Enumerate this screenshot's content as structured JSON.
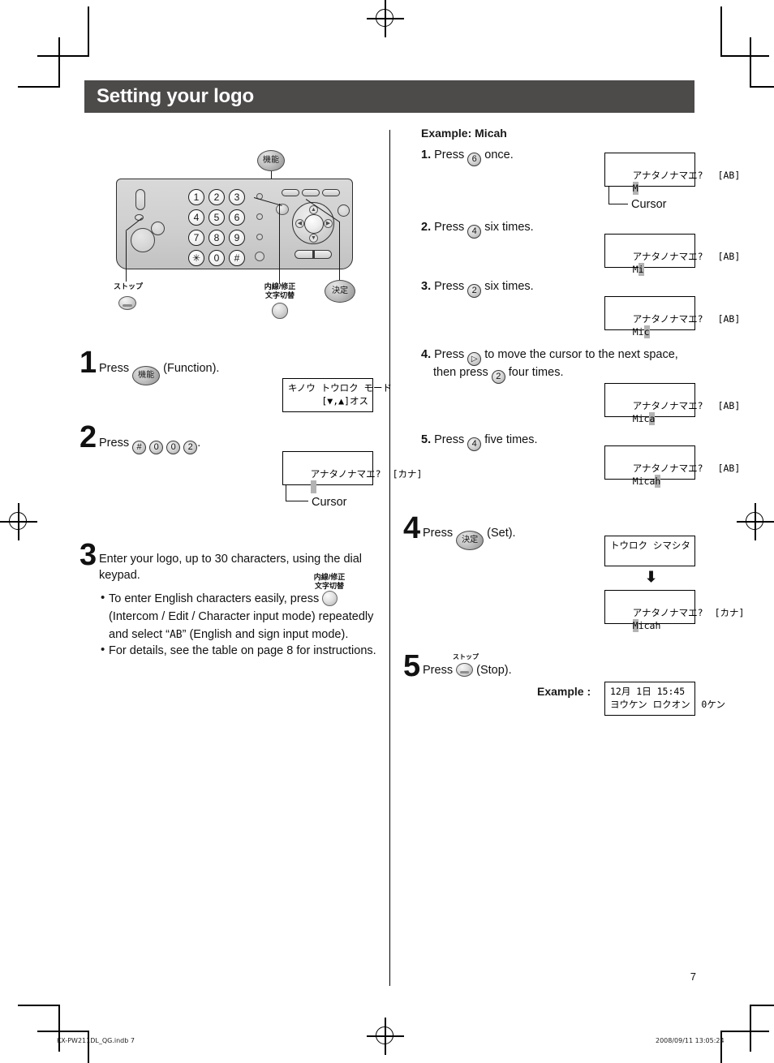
{
  "page": {
    "title": "Setting your logo",
    "page_number": "7",
    "footer_left": "KX-PW211DL_QG.indb   7",
    "footer_right": "2008/09/11   13:05:24"
  },
  "phone_diagram": {
    "keypad": [
      "1",
      "2",
      "3",
      "4",
      "5",
      "6",
      "7",
      "8",
      "9",
      "✳",
      "0",
      "#"
    ],
    "callouts": {
      "function": "機能",
      "stop": "ストップ",
      "intercom_line1": "内線/修正",
      "intercom_line2": "文字切替",
      "set": "決定"
    },
    "nav_arrows": {
      "up": "▲",
      "down": "▼",
      "left": "◀",
      "right": "▶"
    }
  },
  "left_column": {
    "step1": {
      "number": "1",
      "text_before": "Press",
      "button_label": "機能",
      "text_after": "(Function).",
      "lcd": {
        "line1": "キノウ トウロク モード",
        "line2": "[▼,▲]オス"
      }
    },
    "step2": {
      "number": "2",
      "text_before": "Press",
      "keys": [
        "#",
        "0",
        "0",
        "2"
      ],
      "text_after": ".",
      "lcd": {
        "line1_left": "アナタノナマエ?",
        "line1_right": "[カナ]",
        "line2_cursor": " ",
        "line2_rest": ""
      },
      "cursor_label": "Cursor"
    },
    "step3": {
      "number": "3",
      "text_line1": "Enter your logo, up to 30 characters, using the dial",
      "text_line2": "keypad.",
      "bullet1_part1": "To enter English characters easily, press",
      "bullet1_button_line1": "内線/修正",
      "bullet1_button_line2": "文字切替",
      "bullet1_part2": "(Intercom / Edit / Character input mode) repeatedly",
      "bullet1_part3a": "and select “",
      "bullet1_mode": "AB",
      "bullet1_part3b": "” (English and sign input mode).",
      "bullet2": "For details, see the table on page 8 for instructions."
    }
  },
  "right_column": {
    "example_heading": "Example: Micah",
    "sub_steps": [
      {
        "number": "1.",
        "text_before": "Press",
        "key": "6",
        "text_after": "once.",
        "lcd": {
          "line1_left": "アナタノナマエ?",
          "line1_right": "[AB]",
          "cursor_char": "M",
          "tail": ""
        },
        "cursor_label": "Cursor"
      },
      {
        "number": "2.",
        "text_before": "Press",
        "key": "4",
        "text_after": "six times.",
        "lcd": {
          "line1_left": "アナタノナマエ?",
          "line1_right": "[AB]",
          "prefix": "M",
          "cursor_char": "i",
          "tail": ""
        }
      },
      {
        "number": "3.",
        "text_before": "Press",
        "key": "2",
        "text_after": "six times.",
        "lcd": {
          "line1_left": "アナタノナマエ?",
          "line1_right": "[AB]",
          "prefix": "Mi",
          "cursor_char": "c",
          "tail": ""
        }
      },
      {
        "number": "4.",
        "text_line1_before": "Press",
        "key1": "▷",
        "text_line1_after": "to move the cursor to the next space,",
        "text_line2_before": "then press",
        "key2": "2",
        "text_line2_after": "four times.",
        "lcd": {
          "line1_left": "アナタノナマエ?",
          "line1_right": "[AB]",
          "prefix": "Mic",
          "cursor_char": "a",
          "tail": ""
        }
      },
      {
        "number": "5.",
        "text_before": "Press",
        "key": "4",
        "text_after": "five times.",
        "lcd": {
          "line1_left": "アナタノナマエ?",
          "line1_right": "[AB]",
          "prefix": "Mica",
          "cursor_char": "h",
          "tail": ""
        }
      }
    ],
    "step4": {
      "number": "4",
      "text_before": "Press",
      "button_label": "決定",
      "text_after": "(Set).",
      "lcd_first": {
        "line1": "トウロク シマシタ",
        "line2": ""
      },
      "arrow": "⬇",
      "lcd_second": {
        "line1_left": "アナタノナマエ?",
        "line1_right": "[カナ]",
        "cursor_char": "M",
        "tail": "icah"
      }
    },
    "step5": {
      "number": "5",
      "text_before": "Press",
      "button_label": "ストップ",
      "text_after": "(Stop).",
      "example_label": "Example :",
      "lcd": {
        "line1": "12月 1日 15:45",
        "line2": "ヨウケン ロクオン  0ケン"
      }
    }
  },
  "colors": {
    "header_bg": "#4d4a4a",
    "header_text": "#ffffff",
    "cursor_highlight": "#b3b3b3",
    "body_text": "#1a1a1a"
  }
}
